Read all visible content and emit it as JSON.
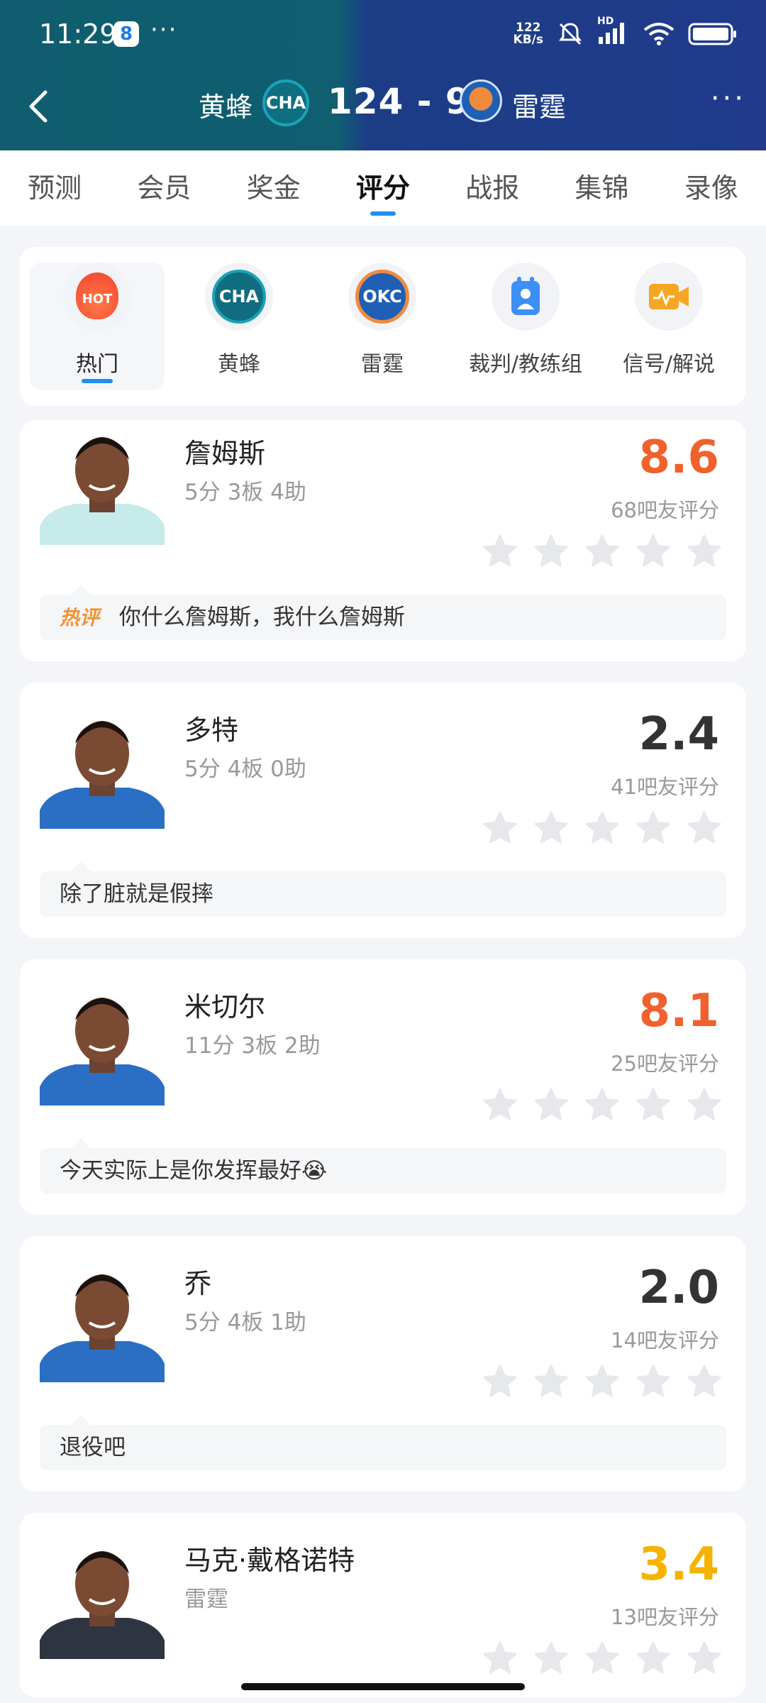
{
  "status_bar": {
    "time": "11:29",
    "app_badge": "8",
    "dots": "···",
    "net_speed_value": "122",
    "net_speed_unit": "KB/s",
    "hd": "HD"
  },
  "header": {
    "team_home": "黄蜂",
    "team_home_logo": "CHA",
    "score": "124 - 97",
    "team_away": "雷霆",
    "team_away_logo": "OKC",
    "more": "···"
  },
  "tabs": [
    {
      "label": "预测"
    },
    {
      "label": "会员"
    },
    {
      "label": "奖金"
    },
    {
      "label": "评分",
      "active": true
    },
    {
      "label": "战报"
    },
    {
      "label": "集锦"
    },
    {
      "label": "录像"
    }
  ],
  "categories": [
    {
      "label": "热门",
      "icon": "hot-icon",
      "icon_text": "HOT",
      "active": true
    },
    {
      "label": "黄蜂",
      "icon": "hornets-logo",
      "icon_text": "CHA"
    },
    {
      "label": "雷霆",
      "icon": "thunder-logo",
      "icon_text": "OKC"
    },
    {
      "label": "裁判/教练组",
      "icon": "referee-icon"
    },
    {
      "label": "信号/解说",
      "icon": "broadcast-icon"
    }
  ],
  "players": [
    {
      "name": "詹姆斯",
      "stats": "5分 3板 4助",
      "rating": "8.6",
      "rating_color": "#f0612e",
      "raters": "68吧友评分",
      "comment_tag": "热评",
      "comment": "你什么詹姆斯，我什么詹姆斯",
      "jersey": "#c6ebea",
      "stars_filled": 0
    },
    {
      "name": "多特",
      "stats": "5分 4板 0助",
      "rating": "2.4",
      "rating_color": "#333333",
      "raters": "41吧友评分",
      "comment_tag": "",
      "comment": "除了脏就是假摔",
      "jersey": "#2b6fc4",
      "stars_filled": 0
    },
    {
      "name": "米切尔",
      "stats": "11分 3板 2助",
      "rating": "8.1",
      "rating_color": "#f0612e",
      "raters": "25吧友评分",
      "comment_tag": "",
      "comment": "今天实际上是你发挥最好😭",
      "jersey": "#2b6fc4",
      "stars_filled": 0
    },
    {
      "name": "乔",
      "stats": "5分 4板 1助",
      "rating": "2.0",
      "rating_color": "#333333",
      "raters": "14吧友评分",
      "comment_tag": "",
      "comment": "退役吧",
      "jersey": "#2b6fc4",
      "stars_filled": 0
    },
    {
      "name": "马克·戴格诺特",
      "stats": "雷霆",
      "rating": "3.4",
      "rating_color": "#f5b300",
      "raters": "13吧友评分",
      "comment_tag": "",
      "comment": "",
      "jersey": "#2e3440",
      "stars_filled": 0
    }
  ]
}
